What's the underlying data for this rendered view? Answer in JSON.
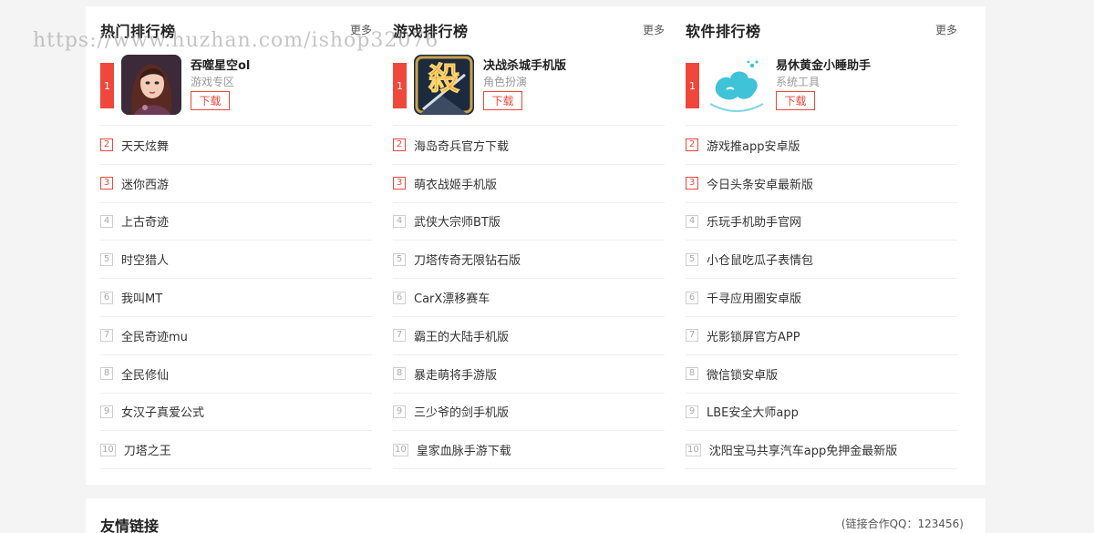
{
  "watermark": "https://www.huzhan.com/ishop32076",
  "columns": [
    {
      "title": "热门排行榜",
      "more": "更多",
      "top": {
        "rank": "1",
        "name": "吞噬星空ol",
        "category": "游戏专区",
        "download": "下载",
        "icon": "game-character-icon"
      },
      "items": [
        {
          "rank": "2",
          "name": "天天炫舞"
        },
        {
          "rank": "3",
          "name": "迷你西游"
        },
        {
          "rank": "4",
          "name": "上古奇迹"
        },
        {
          "rank": "5",
          "name": "时空猎人"
        },
        {
          "rank": "6",
          "name": "我叫MT"
        },
        {
          "rank": "7",
          "name": "全民奇迹mu"
        },
        {
          "rank": "8",
          "name": "全民修仙"
        },
        {
          "rank": "9",
          "name": "女汉子真爱公式"
        },
        {
          "rank": "10",
          "name": "刀塔之王"
        }
      ]
    },
    {
      "title": "游戏排行榜",
      "more": "更多",
      "top": {
        "rank": "1",
        "name": "决战杀城手机版",
        "category": "角色扮演",
        "download": "下载",
        "icon": "kill-character-icon",
        "icon_text": "殺"
      },
      "items": [
        {
          "rank": "2",
          "name": "海岛奇兵官方下载"
        },
        {
          "rank": "3",
          "name": "萌衣战姬手机版"
        },
        {
          "rank": "4",
          "name": "武侠大宗师BT版"
        },
        {
          "rank": "5",
          "name": "刀塔传奇无限钻石版"
        },
        {
          "rank": "6",
          "name": "CarX漂移赛车"
        },
        {
          "rank": "7",
          "name": "霸王的大陆手机版"
        },
        {
          "rank": "8",
          "name": "暴走萌将手游版"
        },
        {
          "rank": "9",
          "name": "三少爷的剑手机版"
        },
        {
          "rank": "10",
          "name": "皇家血脉手游下载"
        }
      ]
    },
    {
      "title": "软件排行榜",
      "more": "更多",
      "top": {
        "rank": "1",
        "name": "易休黄金小睡助手",
        "category": "系统工具",
        "download": "下载",
        "icon": "sleep-cloud-icon"
      },
      "items": [
        {
          "rank": "2",
          "name": "游戏推app安卓版"
        },
        {
          "rank": "3",
          "name": "今日头条安卓最新版"
        },
        {
          "rank": "4",
          "name": "乐玩手机助手官网"
        },
        {
          "rank": "5",
          "name": "小仓鼠吃瓜子表情包"
        },
        {
          "rank": "6",
          "name": "千寻应用圈安卓版"
        },
        {
          "rank": "7",
          "name": "光影锁屏官方APP"
        },
        {
          "rank": "8",
          "name": "微信锁安卓版"
        },
        {
          "rank": "9",
          "name": "LBE安全大师app"
        },
        {
          "rank": "10",
          "name": "沈阳宝马共享汽车app免押金最新版"
        }
      ]
    }
  ],
  "links": {
    "title": "友情链接",
    "note": "(链接合作QQ：123456)"
  },
  "colors": {
    "accent": "#f0473c",
    "divider": "#eeeeee",
    "muted": "#999999"
  }
}
